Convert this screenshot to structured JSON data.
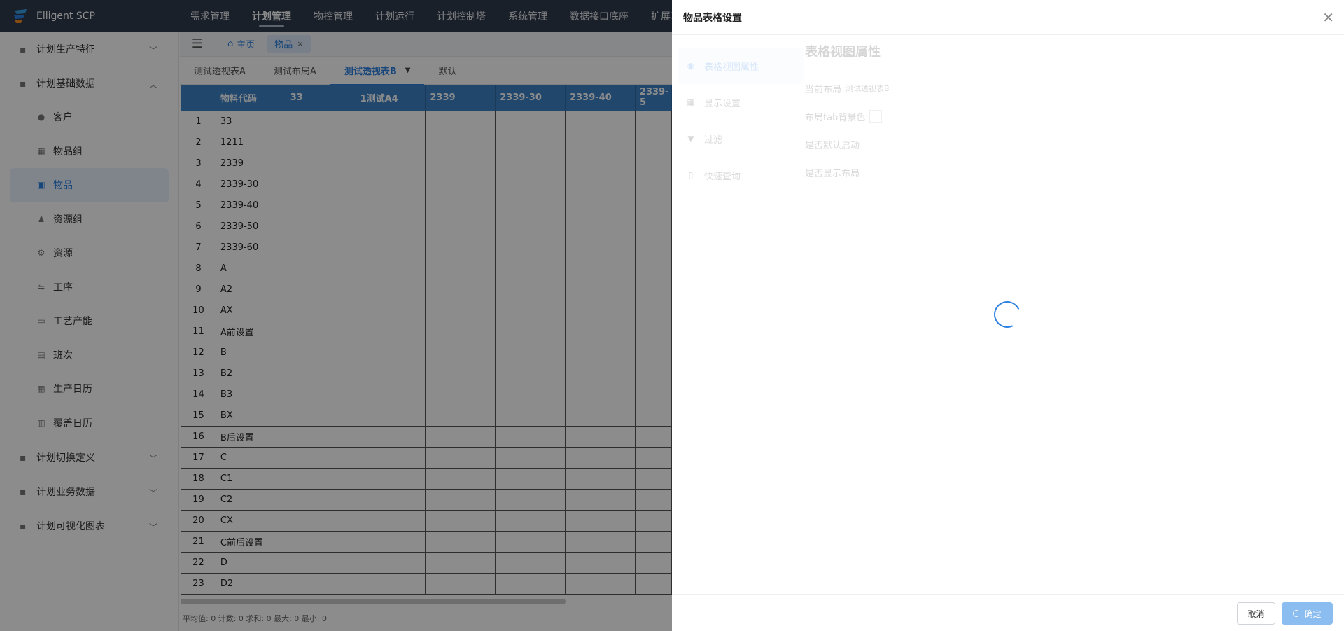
{
  "app": {
    "name": "Elligent SCP"
  },
  "topnav": [
    "需求管理",
    "计划管理",
    "物控管理",
    "计划运行",
    "计划控制塔",
    "系统管理",
    "数据接口底座",
    "扩展功"
  ],
  "topnav_active_index": 1,
  "sidebar": {
    "groups": [
      {
        "label": "计划生产特征",
        "expanded": false
      },
      {
        "label": "计划基础数据",
        "expanded": true,
        "items": [
          {
            "label": "客户",
            "icon": "user-icon"
          },
          {
            "label": "物品组",
            "icon": "grid-icon"
          },
          {
            "label": "物品",
            "icon": "box-icon",
            "active": true
          },
          {
            "label": "资源组",
            "icon": "people-icon"
          },
          {
            "label": "资源",
            "icon": "gear-icon"
          },
          {
            "label": "工序",
            "icon": "process-icon"
          },
          {
            "label": "工艺产能",
            "icon": "capacity-icon"
          },
          {
            "label": "班次",
            "icon": "shift-icon"
          },
          {
            "label": "生产日历",
            "icon": "calendar-icon"
          },
          {
            "label": "覆盖日历",
            "icon": "calendar-cover-icon"
          }
        ]
      },
      {
        "label": "计划切换定义",
        "expanded": false
      },
      {
        "label": "计划业务数据",
        "expanded": false
      },
      {
        "label": "计划可视化图表",
        "expanded": false
      }
    ]
  },
  "page_tabs": {
    "home": "主页",
    "current": "物品"
  },
  "view_tabs": [
    "测试透视表A",
    "测试布局A",
    "测试透视表B",
    "默认"
  ],
  "view_tabs_active_index": 2,
  "grid": {
    "columns": [
      "",
      "物料代码",
      "33",
      "1测试A4",
      "2339",
      "2339-30",
      "2339-40",
      "2339-5"
    ],
    "rows": [
      [
        "1",
        "33"
      ],
      [
        "2",
        "1211"
      ],
      [
        "3",
        "2339"
      ],
      [
        "4",
        "2339-30"
      ],
      [
        "5",
        "2339-40"
      ],
      [
        "6",
        "2339-50"
      ],
      [
        "7",
        "2339-60"
      ],
      [
        "8",
        "A"
      ],
      [
        "9",
        "A2"
      ],
      [
        "10",
        "AX"
      ],
      [
        "11",
        "A前设置"
      ],
      [
        "12",
        "B"
      ],
      [
        "13",
        "B2"
      ],
      [
        "14",
        "B3"
      ],
      [
        "15",
        "BX"
      ],
      [
        "16",
        "B后设置"
      ],
      [
        "17",
        "C"
      ],
      [
        "18",
        "C1"
      ],
      [
        "19",
        "C2"
      ],
      [
        "20",
        "CX"
      ],
      [
        "21",
        "C前后设置"
      ],
      [
        "22",
        "D"
      ],
      [
        "23",
        "D2"
      ]
    ]
  },
  "statusbar": "平均值: 0 计数: 0 求和: 0 最大: 0 最小: 0",
  "drawer": {
    "title": "物品表格设置",
    "nav": [
      {
        "label": "表格视图属性",
        "icon": "eye-icon",
        "active": true
      },
      {
        "label": "显示设置",
        "icon": "table-icon"
      },
      {
        "label": "过滤",
        "icon": "filter-icon"
      },
      {
        "label": "快速查询",
        "icon": "file-icon"
      }
    ],
    "content": {
      "title": "表格视图属性",
      "current_layout_label": "当前布局",
      "current_layout_value": "测试透视表B",
      "tab_bg_label": "布局tab背景色",
      "default_label": "是否默认启动",
      "show_layout_label": "是否显示布局"
    },
    "cancel": "取消",
    "ok": "确定"
  },
  "colors": {
    "header": "#2f3b4c",
    "accent": "#2d80e0",
    "grid_header": "#3d82c7"
  }
}
